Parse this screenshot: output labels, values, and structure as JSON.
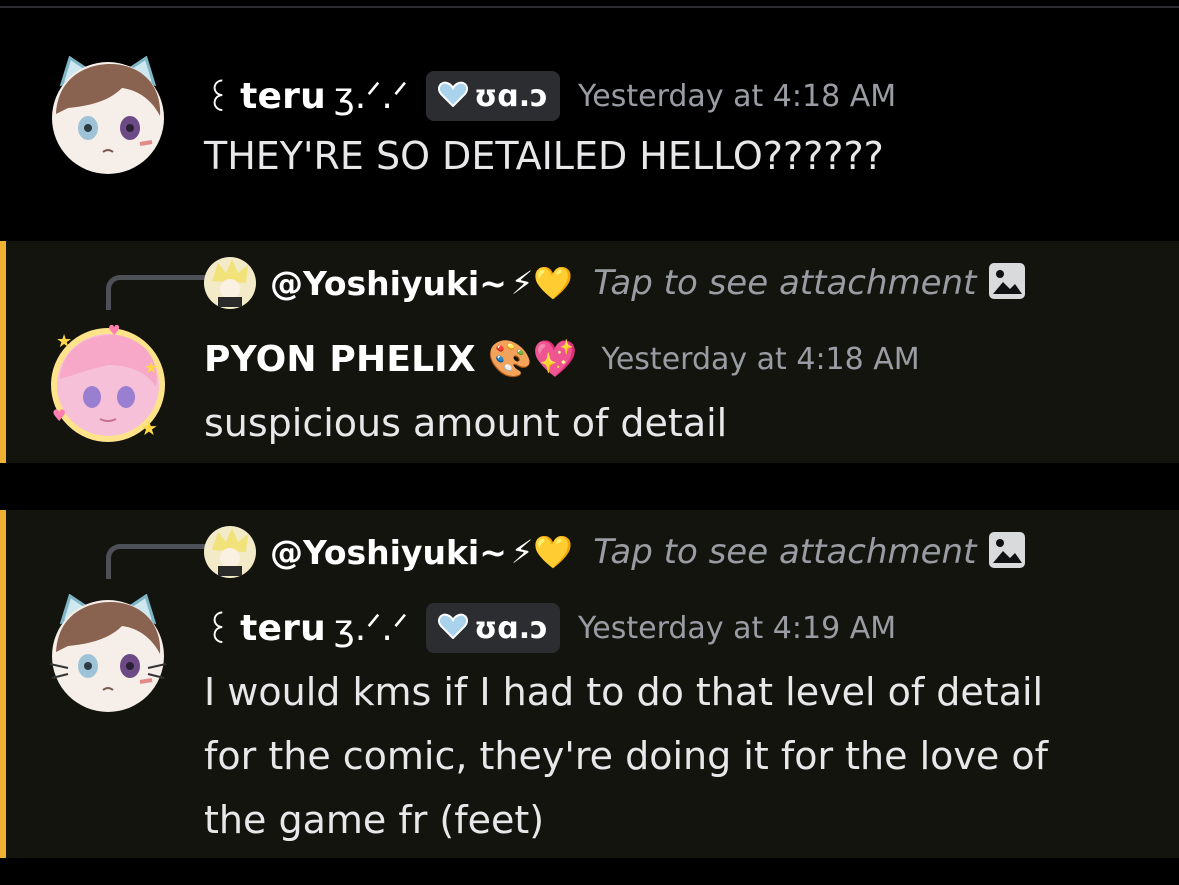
{
  "colors": {
    "background": "#000000",
    "highlight_bg": "#14140f",
    "mention_bar": "#f0b232",
    "timestamp": "#9a9ca3",
    "tag_bg": "#2b2d31"
  },
  "messages": [
    {
      "author_prefix": "꒰",
      "author": "teru",
      "author_suffix": "ʒ.ᐟ.ᐟ",
      "tag_icon": "heart-icon",
      "tag_text": "ʊɑ.ɔ",
      "timestamp": "Yesterday at 4:18 AM",
      "text": "THEY'RE SO DETAILED HELLO??????"
    },
    {
      "reply": {
        "name": "@Yoshiyuki~",
        "emojis": "⚡💛",
        "preview": "Tap to see attachment",
        "preview_icon": "image-icon"
      },
      "author": "PYON PHELIX",
      "author_emojis": "🎨💖",
      "timestamp": "Yesterday at 4:18 AM",
      "text": "suspicious amount of detail"
    },
    {
      "reply": {
        "name": "@Yoshiyuki~",
        "emojis": "⚡💛",
        "preview": "Tap to see attachment",
        "preview_icon": "image-icon"
      },
      "author_prefix": "꒰",
      "author": "teru",
      "author_suffix": "ʒ.ᐟ.ᐟ",
      "tag_icon": "heart-icon",
      "tag_text": "ʊɑ.ɔ",
      "timestamp": "Yesterday at 4:19 AM",
      "text_lines": [
        "I would kms if I had to do that level of detail",
        "for the comic, they're doing it for the love of",
        "the game fr (feet)"
      ]
    }
  ]
}
